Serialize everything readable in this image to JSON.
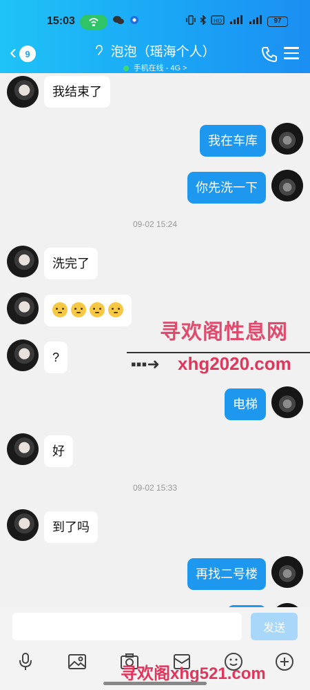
{
  "status": {
    "time": "15:03",
    "battery": "97"
  },
  "header": {
    "back_badge": "9",
    "title": "泡泡（瑶海个人）",
    "subtitle": "手机在线 - 4G >"
  },
  "messages": [
    {
      "side": "left",
      "text": "我结束了"
    },
    {
      "side": "right",
      "text": "我在车库"
    },
    {
      "side": "right",
      "text": "你先洗一下"
    },
    {
      "type": "time",
      "text": "09-02 15:24"
    },
    {
      "side": "left",
      "text": "洗完了"
    },
    {
      "side": "left",
      "emoji_count": 4,
      "emoji_name": "thinking-face-emoji"
    },
    {
      "side": "left",
      "text": "?"
    },
    {
      "side": "right",
      "text": "电梯"
    },
    {
      "side": "left",
      "text": "好"
    },
    {
      "type": "time",
      "text": "09-02 15:33"
    },
    {
      "side": "left",
      "text": "到了吗"
    },
    {
      "side": "right",
      "text": "再找二号楼"
    }
  ],
  "watermarks": {
    "line1": "寻欢阁性息网",
    "line2": "xhg2020.com",
    "line3": "寻欢阁xhg521.com"
  },
  "input": {
    "placeholder": "",
    "send_label": "发送"
  },
  "toolbar": [
    "microphone-icon",
    "image-icon",
    "camera-icon",
    "red-packet-icon",
    "emoji-icon",
    "plus-icon"
  ],
  "colors": {
    "header_start": "#1fc3f7",
    "header_end": "#1b8ff2",
    "bubble_right": "#1e97ee",
    "send_disabled": "#a9d7f9"
  }
}
